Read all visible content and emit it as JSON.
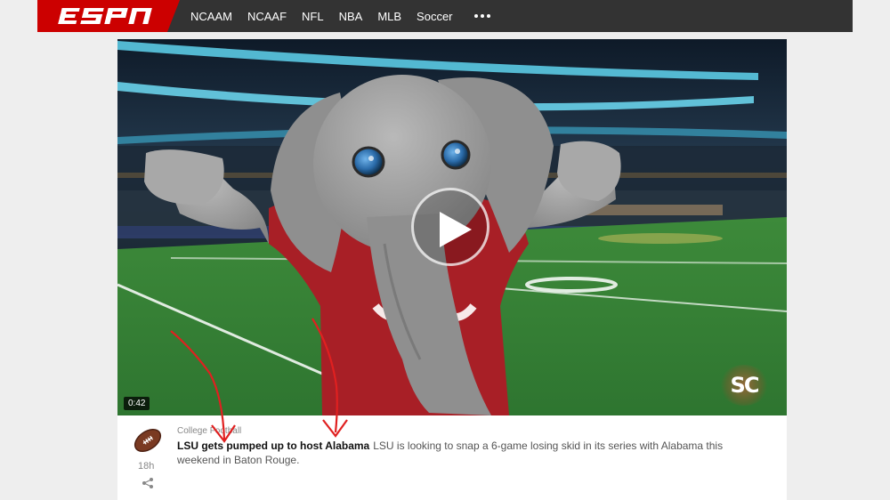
{
  "brand": {
    "name": "ESPN",
    "color": "#cc0000"
  },
  "nav": {
    "items": [
      "NCAAM",
      "NCAAF",
      "NFL",
      "NBA",
      "MLB",
      "Soccer"
    ],
    "more_icon": "ellipsis-icon"
  },
  "video": {
    "duration": "0:42",
    "play_icon": "play-icon",
    "watermark": "SC"
  },
  "story": {
    "category": "College Football",
    "title": "LSU gets pumped up to host Alabama",
    "summary": "LSU is looking to snap a 6-game losing skid in its series with Alabama this weekend in Baton Rouge.",
    "time_ago": "18h",
    "sport_icon": "football-icon",
    "share_icon": "share-icon"
  },
  "annotation_color": "#e02020"
}
